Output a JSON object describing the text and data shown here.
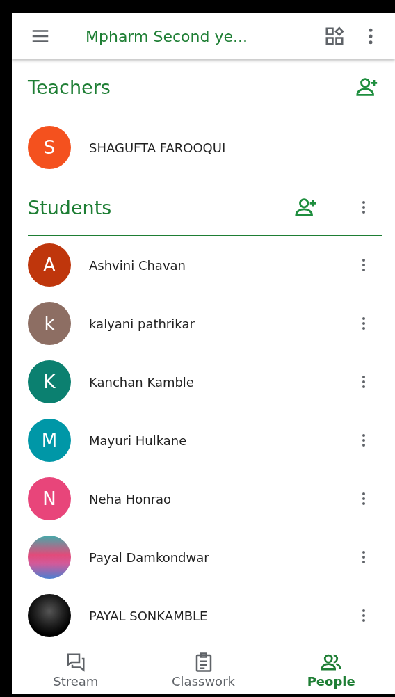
{
  "app_bar": {
    "title": "Mpharm Second ye..."
  },
  "teachers": {
    "heading": "Teachers",
    "people": [
      {
        "kind": "letter",
        "initial": "S",
        "color": "#f4511e",
        "name": "SHAGUFTA FAROOQUI"
      }
    ]
  },
  "students": {
    "heading": "Students",
    "people": [
      {
        "kind": "letter",
        "initial": "A",
        "color": "#bf360c",
        "name": "Ashvini Chavan"
      },
      {
        "kind": "letter",
        "initial": "k",
        "color": "#8d6e63",
        "name": "kalyani pathrikar"
      },
      {
        "kind": "letter",
        "initial": "K",
        "color": "#0b8070",
        "name": "Kanchan Kamble"
      },
      {
        "kind": "letter",
        "initial": "M",
        "color": "#0097a7",
        "name": "Mayuri Hulkane"
      },
      {
        "kind": "letter",
        "initial": "N",
        "color": "#e8457a",
        "name": "Neha Honrao"
      },
      {
        "kind": "photo",
        "name": "Payal Damkondwar"
      },
      {
        "kind": "photo",
        "name": "PAYAL SONKAMBLE"
      }
    ]
  },
  "bottom_nav": [
    {
      "kind": "stream",
      "label": "Stream",
      "selected": false
    },
    {
      "kind": "classwork",
      "label": "Classwork",
      "selected": false
    },
    {
      "kind": "people",
      "label": "People",
      "selected": true
    }
  ]
}
